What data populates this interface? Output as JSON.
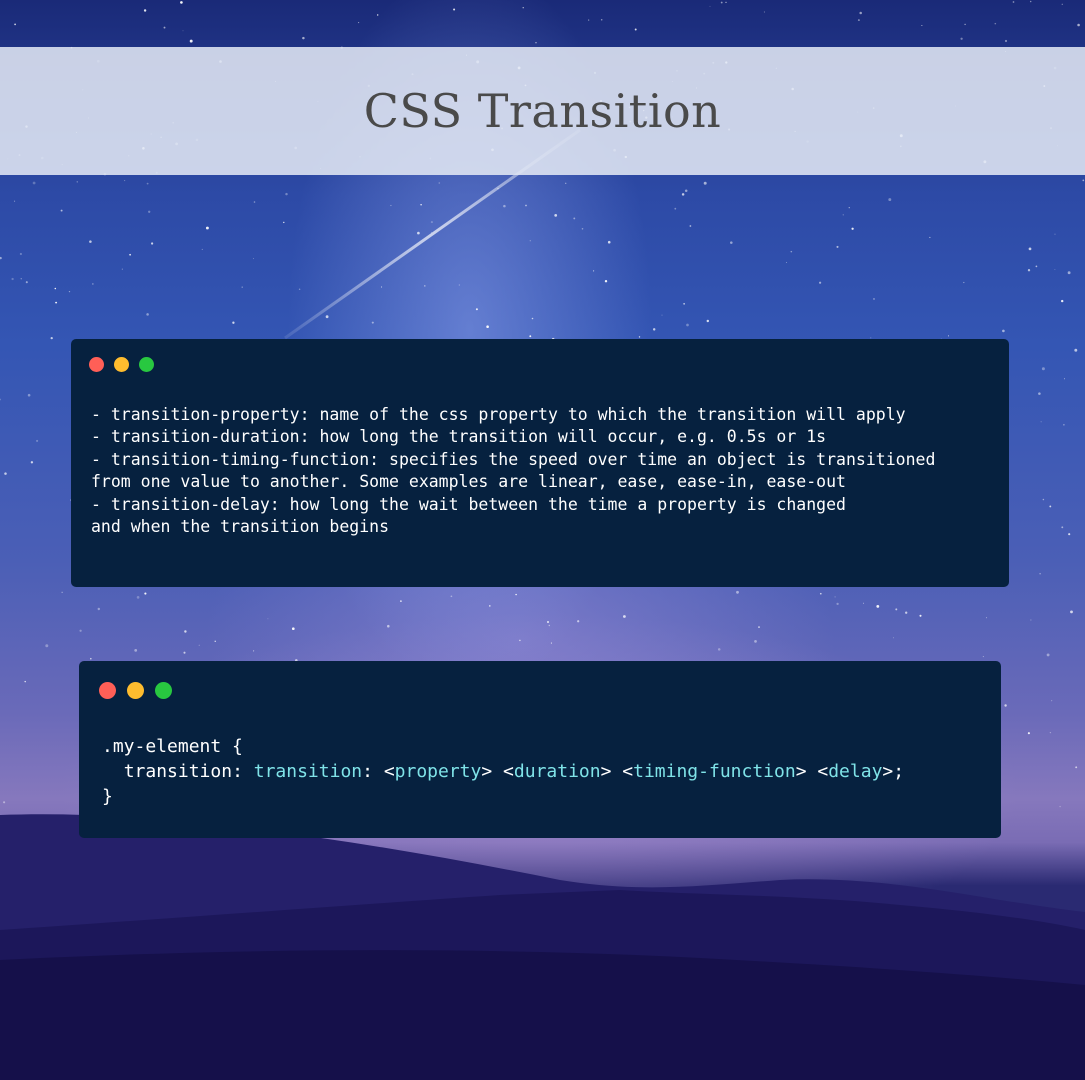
{
  "title": "CSS Transition",
  "window_one": {
    "controls": [
      "close",
      "minimize",
      "maximize"
    ],
    "lines": [
      "- transition-property: name of the css property to which the transition will apply",
      "- transition-duration: how long the transition will occur, e.g. 0.5s or 1s",
      "- transition-timing-function: specifies the speed over time an object is transitioned",
      "from one value to another. Some examples are linear, ease, ease-in, ease-out",
      "- transition-delay: how long the wait between the time a property is changed",
      "and when the transition begins"
    ]
  },
  "window_two": {
    "controls": [
      "close",
      "minimize",
      "maximize"
    ],
    "selector_line": ".my-element {",
    "prop_name": "transition",
    "colon": ": ",
    "value_head": "transition",
    "value_colon": ": ",
    "lt1": "<",
    "token1": "property",
    "gt1": "> ",
    "lt2": "<",
    "token2": "duration",
    "gt2": "> ",
    "lt3": "<",
    "token3": "timing-function",
    "gt3": "> ",
    "lt4": "<",
    "token4": "delay",
    "gt4": ">;",
    "closing": "}"
  },
  "colors": {
    "window_bg": "#06213f",
    "close": "#ff5f57",
    "minimize": "#febc2e",
    "maximize": "#28c840",
    "code_accent": "#7fe3e8",
    "title_text": "#4a4a4a"
  }
}
